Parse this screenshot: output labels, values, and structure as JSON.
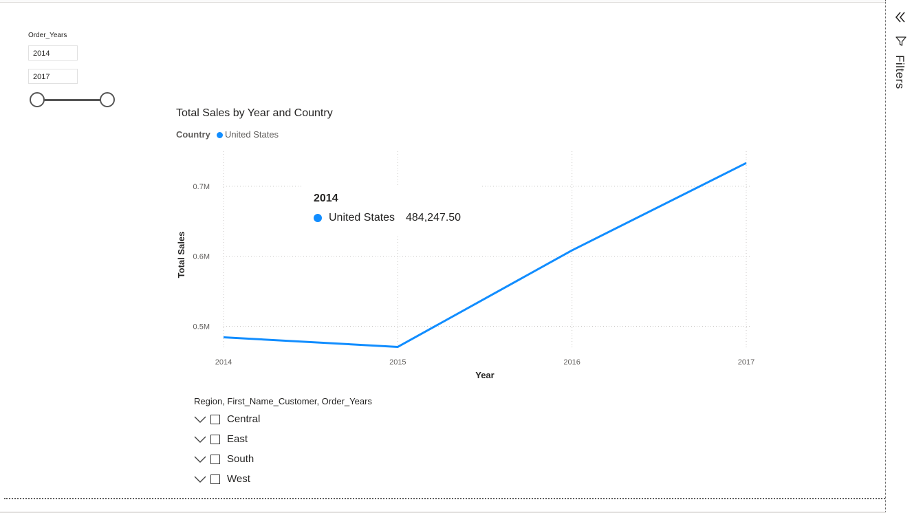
{
  "slicer": {
    "title": "Order_Years",
    "start": "2014",
    "end": "2017"
  },
  "chart": {
    "title": "Total Sales by Year and Country",
    "legend_title": "Country",
    "legend_series": "United States",
    "line_color": "#118dff",
    "tooltip": {
      "year": "2014",
      "series": "United States",
      "value": "484,247.50"
    }
  },
  "chart_data": {
    "type": "line",
    "title": "Total Sales by Year and Country",
    "xlabel": "Year",
    "ylabel": "Total Sales",
    "x": [
      "2014",
      "2015",
      "2016",
      "2017"
    ],
    "y_ticks": [
      500000,
      600000,
      700000
    ],
    "y_tick_labels": [
      "0.5M",
      "0.6M",
      "0.7M"
    ],
    "ylim": [
      0.47,
      0.75
    ],
    "grid": true,
    "legend_placement": "top-left",
    "series": [
      {
        "name": "United States",
        "color": "#118dff",
        "values": [
          484247.5,
          470533,
          608474,
          733215
        ]
      }
    ]
  },
  "hierarchy": {
    "title": "Region, First_Name_Customer, Order_Years",
    "items": [
      {
        "label": "Central"
      },
      {
        "label": "East"
      },
      {
        "label": "South"
      },
      {
        "label": "West"
      }
    ]
  },
  "filters_pane": {
    "label": "Filters",
    "collapse_icon": "double-chevron-left-icon",
    "funnel_icon": "funnel-icon"
  }
}
